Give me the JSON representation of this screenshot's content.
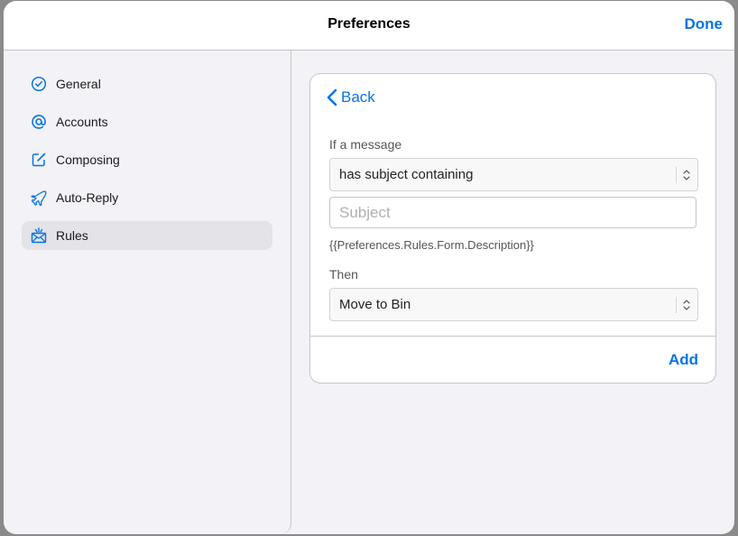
{
  "header": {
    "title": "Preferences",
    "done_label": "Done"
  },
  "sidebar": {
    "items": [
      {
        "label": "General",
        "icon": "checkmark-circle-icon",
        "active": false
      },
      {
        "label": "Accounts",
        "icon": "at-icon",
        "active": false
      },
      {
        "label": "Composing",
        "icon": "compose-icon",
        "active": false
      },
      {
        "label": "Auto-Reply",
        "icon": "airplane-icon",
        "active": false
      },
      {
        "label": "Rules",
        "icon": "mail-rules-icon",
        "active": true
      }
    ]
  },
  "rule_form": {
    "back_label": "Back",
    "condition_label": "If a message",
    "condition_value": "has subject containing",
    "subject_placeholder": "Subject",
    "subject_value": "",
    "description": "{{Preferences.Rules.Form.Description}}",
    "action_label": "Then",
    "action_value": "Move to Bin",
    "add_label": "Add"
  },
  "colors": {
    "accent": "#0a74e4",
    "sidebar_bg": "#f2f2f7",
    "active_item_bg": "#e3e3e8"
  }
}
